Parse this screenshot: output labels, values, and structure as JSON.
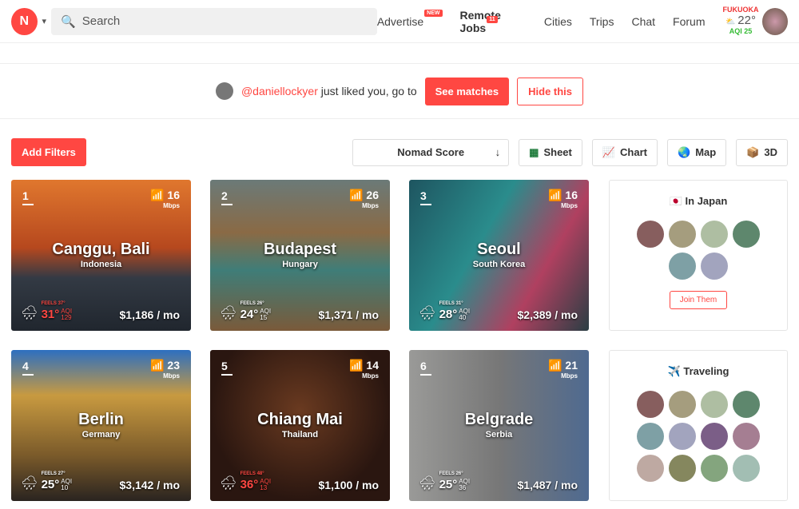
{
  "header": {
    "search_placeholder": "Search",
    "nav": [
      {
        "label": "Advertise",
        "badge": "NEW"
      },
      {
        "label": "Remote Jobs",
        "badge": "11"
      },
      {
        "label": "Cities"
      },
      {
        "label": "Trips"
      },
      {
        "label": "Chat"
      },
      {
        "label": "Forum"
      }
    ],
    "weather": {
      "city": "FUKUOKA",
      "temp": "22°",
      "aqi": "AQI 25"
    }
  },
  "notice": {
    "user": "@daniellockyer",
    "text": "just liked you, go to",
    "see": "See matches",
    "hide": "Hide this"
  },
  "toolbar": {
    "add_filters": "Add Filters",
    "sort": "Nomad Score",
    "sort_icon": "↓",
    "sheet": "Sheet",
    "chart": "Chart",
    "map": "Map",
    "three_d": "3D"
  },
  "cities": [
    {
      "rank": "1",
      "name": "Canggu, Bali",
      "country": "Indonesia",
      "speed": "16",
      "unit": "Mbps",
      "feels": "FEELS 37°",
      "temp": "31°",
      "aqi": "129",
      "price": "$1,186 / mo",
      "hot": true,
      "bg": "linear-gradient(#e0772e,#b6481e 45%,#333a44 65%,#20262e)"
    },
    {
      "rank": "2",
      "name": "Budapest",
      "country": "Hungary",
      "speed": "26",
      "unit": "Mbps",
      "feels": "FEELS 26°",
      "temp": "24°",
      "aqi": "15",
      "price": "$1,371 / mo",
      "hot": false,
      "bg": "linear-gradient(#6b7a78,#8a6a45 35%,#3f7d78 60%,#7a5a3a)"
    },
    {
      "rank": "3",
      "name": "Seoul",
      "country": "South Korea",
      "speed": "16",
      "unit": "Mbps",
      "feels": "FEELS 31°",
      "temp": "28°",
      "aqi": "40",
      "price": "$2,389 / mo",
      "hot": false,
      "bg": "linear-gradient(120deg,#1e5560,#2a8c8c 40%,#b04060 70%,#2a3e44)"
    },
    {
      "rank": "4",
      "name": "Berlin",
      "country": "Germany",
      "speed": "23",
      "unit": "Mbps",
      "feels": "FEELS 27°",
      "temp": "25°",
      "aqi": "10",
      "price": "$3,142 / mo",
      "hot": false,
      "bg": "linear-gradient(#2d6fc0,#c89a40 30%,#7a5a2a 70%,#2a2420)"
    },
    {
      "rank": "5",
      "name": "Chiang Mai",
      "country": "Thailand",
      "speed": "14",
      "unit": "Mbps",
      "feels": "FEELS 48°",
      "temp": "36°",
      "aqi": "13",
      "price": "$1,100 / mo",
      "hot": true,
      "bg": "radial-gradient(circle at 50% 40%,#6a3a20,#2a1610 70%)"
    },
    {
      "rank": "6",
      "name": "Belgrade",
      "country": "Serbia",
      "speed": "21",
      "unit": "Mbps",
      "feels": "FEELS 26°",
      "temp": "25°",
      "aqi": "36",
      "price": "$1,487 / mo",
      "hot": false,
      "bg": "linear-gradient(90deg,#9a9a98,#777 50%,#4f6a90)"
    }
  ],
  "in_japan": {
    "title": "In Japan",
    "flag": "🇯🇵",
    "join": "Join Them",
    "count": 6
  },
  "traveling": {
    "title": "Traveling",
    "icon": "✈️",
    "count": 12
  }
}
